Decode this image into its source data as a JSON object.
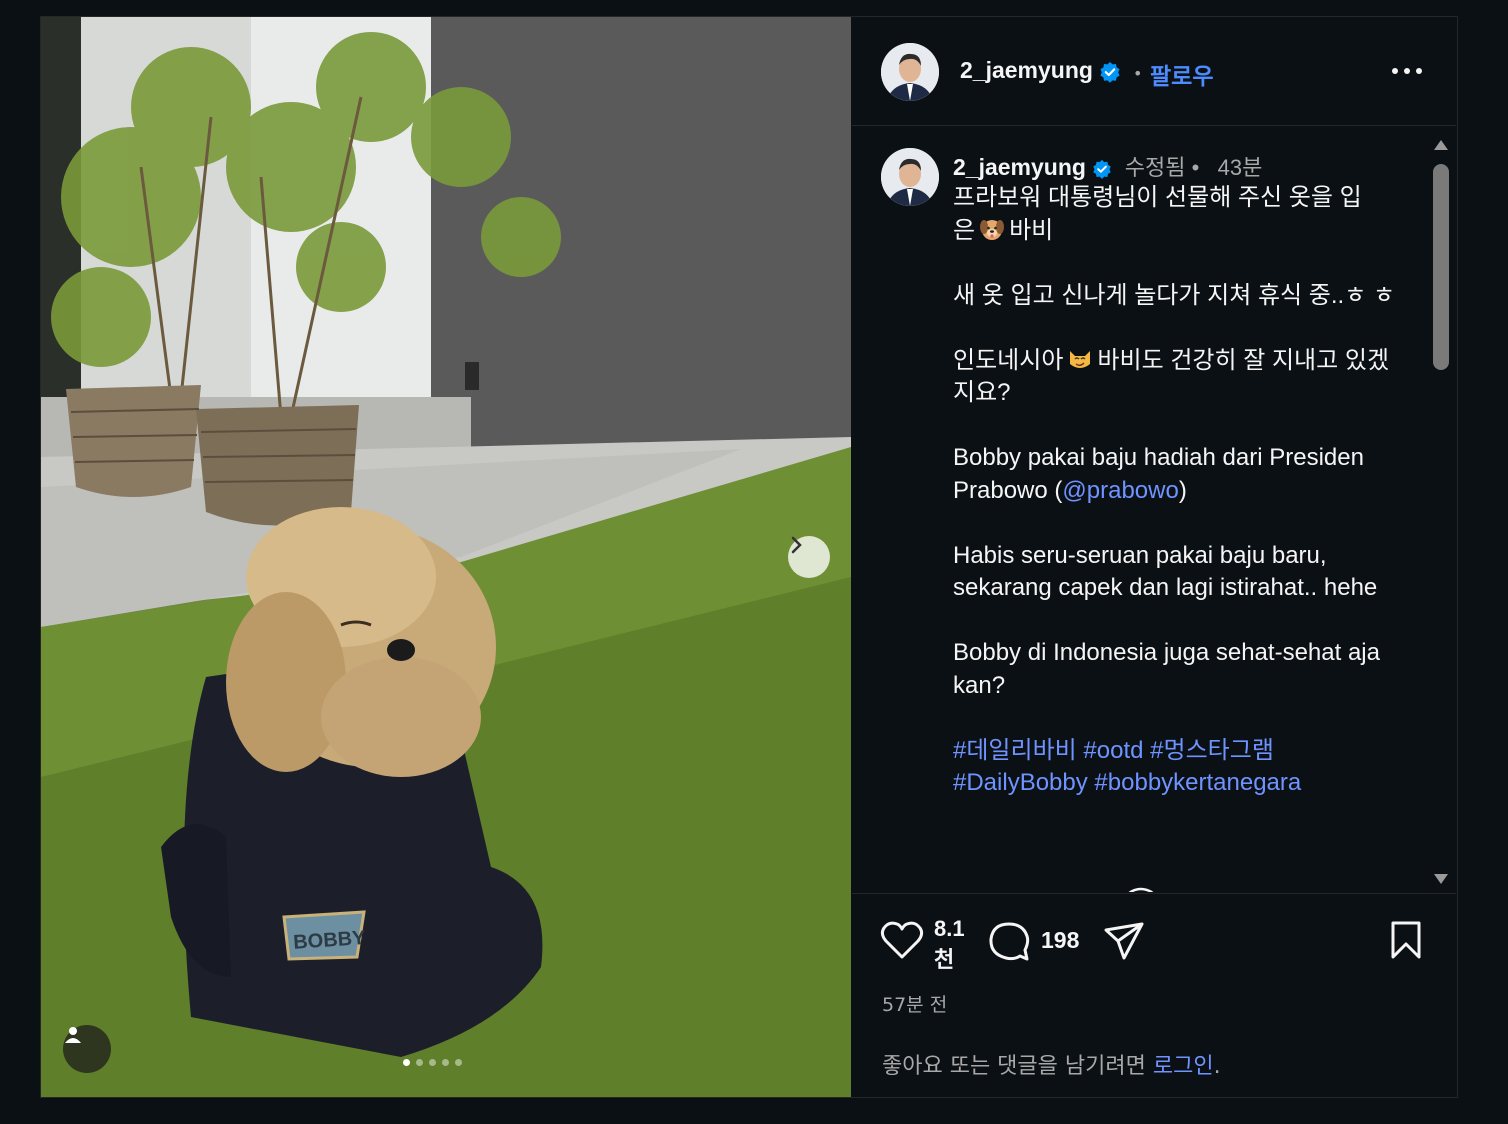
{
  "post": {
    "username": "2_jaemyung",
    "follow_label": "팔로우",
    "header_separator": "•",
    "edited_label": "수정됨 •",
    "time_ago": "43분",
    "caption_lines": {
      "p1a": "프라보워 대통령님이 선물해 주신 옷을 입",
      "p1b_pre": "은",
      "p1b_post": "바비",
      "p2": "새 옷 입고 신나게 놀다가 지쳐 휴식 중..ㅎ ㅎ",
      "p3_pre": "인도네시아",
      "p3_post": "바비도 건강히 잘 지내고 있겠지요?",
      "p4_pre": "Bobby pakai baju hadiah dari Presiden Prabowo (",
      "p4_mention": "@prabowo",
      "p4_post": ")",
      "p5": "Habis seru-seruan pakai baju baru, sekarang capek dan lagi istirahat.. hehe",
      "p6": "Bobby di Indonesia juga sehat-sehat aja kan?"
    },
    "hashtags": [
      "#데일리바비",
      "#ootd",
      "#멍스타그램",
      "#DailyBobby",
      "#bobbykertanegara"
    ],
    "likes": "8.1\n천",
    "likes_line1": "8.1",
    "likes_line2": "천",
    "comments": "198",
    "posted": "57분 전",
    "login_prompt": "좋아요 또는 댓글을 남기려면",
    "login_link": "로그인",
    "login_suffix": "."
  },
  "media": {
    "slide_count": 5,
    "active_slide": 1,
    "dog_shirt_text": "BOBBY"
  },
  "icons": {
    "verified": "verified-badge-icon",
    "more": "more-options-icon",
    "like": "heart-icon",
    "comment": "comment-icon",
    "share": "share-icon",
    "save": "bookmark-icon",
    "next": "chevron-right-icon",
    "tag": "user-tag-icon"
  },
  "colors": {
    "background": "#0b1014",
    "link": "#6f93ff",
    "verified": "#0095f6",
    "follow": "#4c8cff",
    "muted": "#a8a8a8"
  }
}
